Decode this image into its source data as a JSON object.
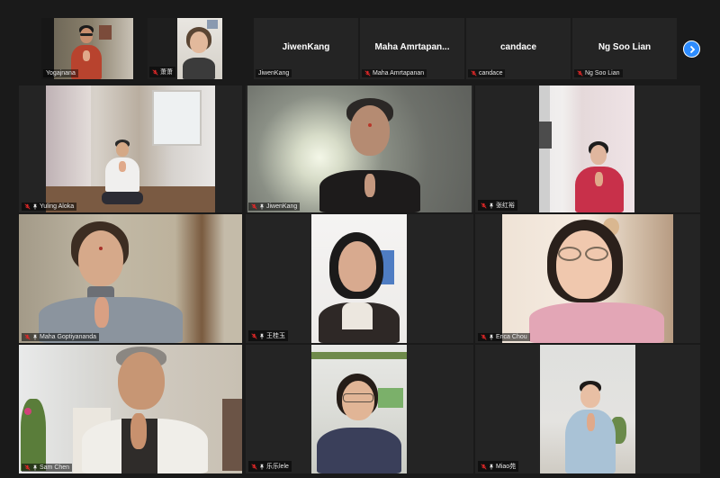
{
  "strip": {
    "tiles": [
      {
        "label": "Yogajnana",
        "center_name": "",
        "muted": false
      },
      {
        "label": "萧萧",
        "center_name": "",
        "muted": true
      },
      {
        "label": "JiwenKang",
        "center_name": "JiwenKang",
        "muted": false
      },
      {
        "label": "Maha Amrtapanan",
        "center_name": "Maha  Amrtapan...",
        "muted": true
      },
      {
        "label": "candace",
        "center_name": "candace",
        "muted": true
      },
      {
        "label": "Ng Soo Lian",
        "center_name": "Ng Soo Lian",
        "muted": true
      }
    ],
    "next_icon": "chevron-right-icon"
  },
  "grid": {
    "tiles": [
      {
        "label": "Yuling Aloka"
      },
      {
        "label": "JiwenKang"
      },
      {
        "label": "张红裕"
      },
      {
        "label": "Maha Goptiyananda"
      },
      {
        "label": "王桂玉"
      },
      {
        "label": "Erica Chou"
      },
      {
        "label": "Sam Chen"
      },
      {
        "label": "乐乐lele"
      },
      {
        "label": "Miao苑"
      }
    ]
  },
  "colors": {
    "background": "#1a1a1a",
    "tile": "#242424",
    "accent_blue": "#2d8cff",
    "mute_red": "#e02828"
  }
}
